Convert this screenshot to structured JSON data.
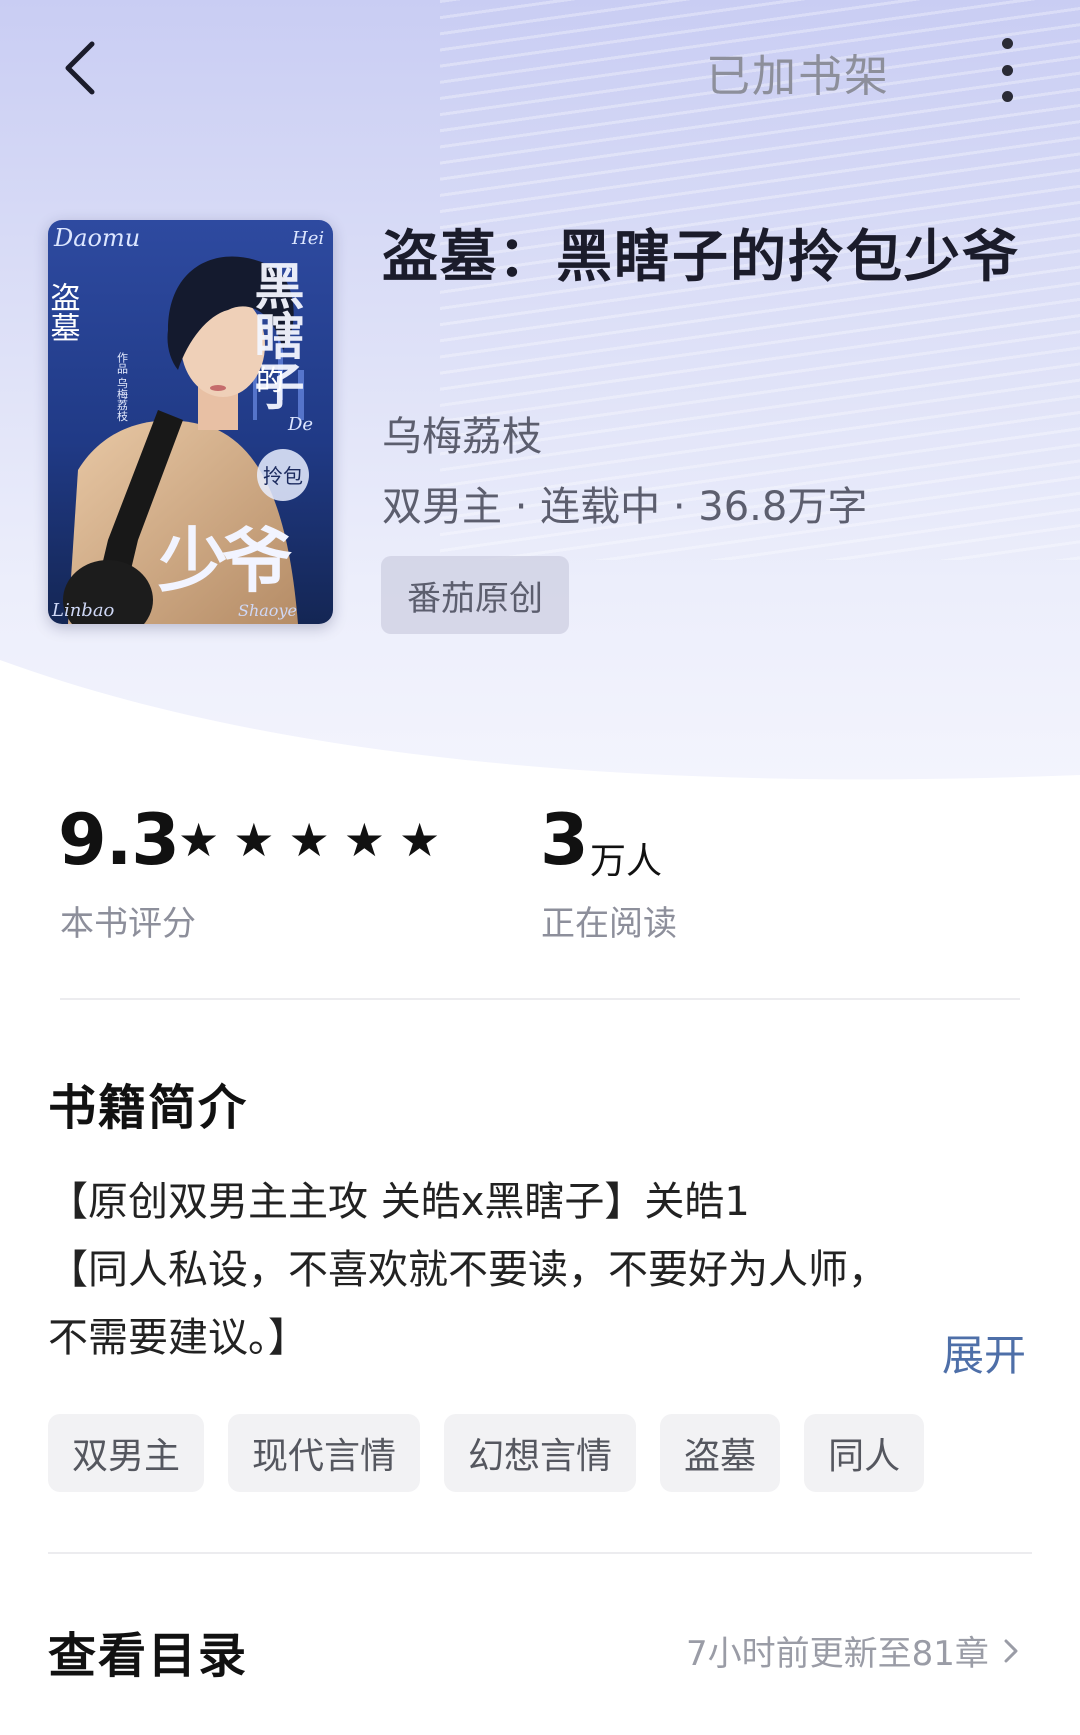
{
  "nav": {
    "shelf_status": "已加书架"
  },
  "book": {
    "title": "盗墓：黑瞎子的拎包少爷",
    "author": "乌梅荔枝",
    "meta": "双男主 · 连载中 · 36.8万字",
    "origin_tag": "番茄原创",
    "cover": {
      "latin_top": "Daomu",
      "latin_hei": "Hei",
      "series_vertical": "盗墓",
      "title_big_vertical": "黑瞎子",
      "title_de": "的",
      "latin_de": "De",
      "title_lingbao": "拎包",
      "title_shaoye": "少爷",
      "author_credit": "作品 乌梅荔枝",
      "latin_bottom_left": "Linbao",
      "latin_bottom_right": "Shaoye"
    }
  },
  "stats": {
    "rating": "9.3",
    "rating_stars": 5,
    "rating_label": "本书评分",
    "readers_number": "3",
    "readers_unit": "万人",
    "readers_label": "正在阅读"
  },
  "intro": {
    "heading": "书籍简介",
    "lines": [
      "【原创双男主主攻 关皓x黑瞎子】关皓1",
      "【同人私设，不喜欢就不要读，不要好为人师，",
      "不需要建议。】"
    ],
    "expand_label": "展开"
  },
  "tags": [
    "双男主",
    "现代言情",
    "幻想言情",
    "盗墓",
    "同人"
  ],
  "toc": {
    "heading": "查看目录",
    "update_text": "7小时前更新至81章"
  },
  "colors": {
    "hero_top": "#c9cdf3",
    "link_blue": "#4e6fa8",
    "muted_text": "#8d8f9b"
  }
}
